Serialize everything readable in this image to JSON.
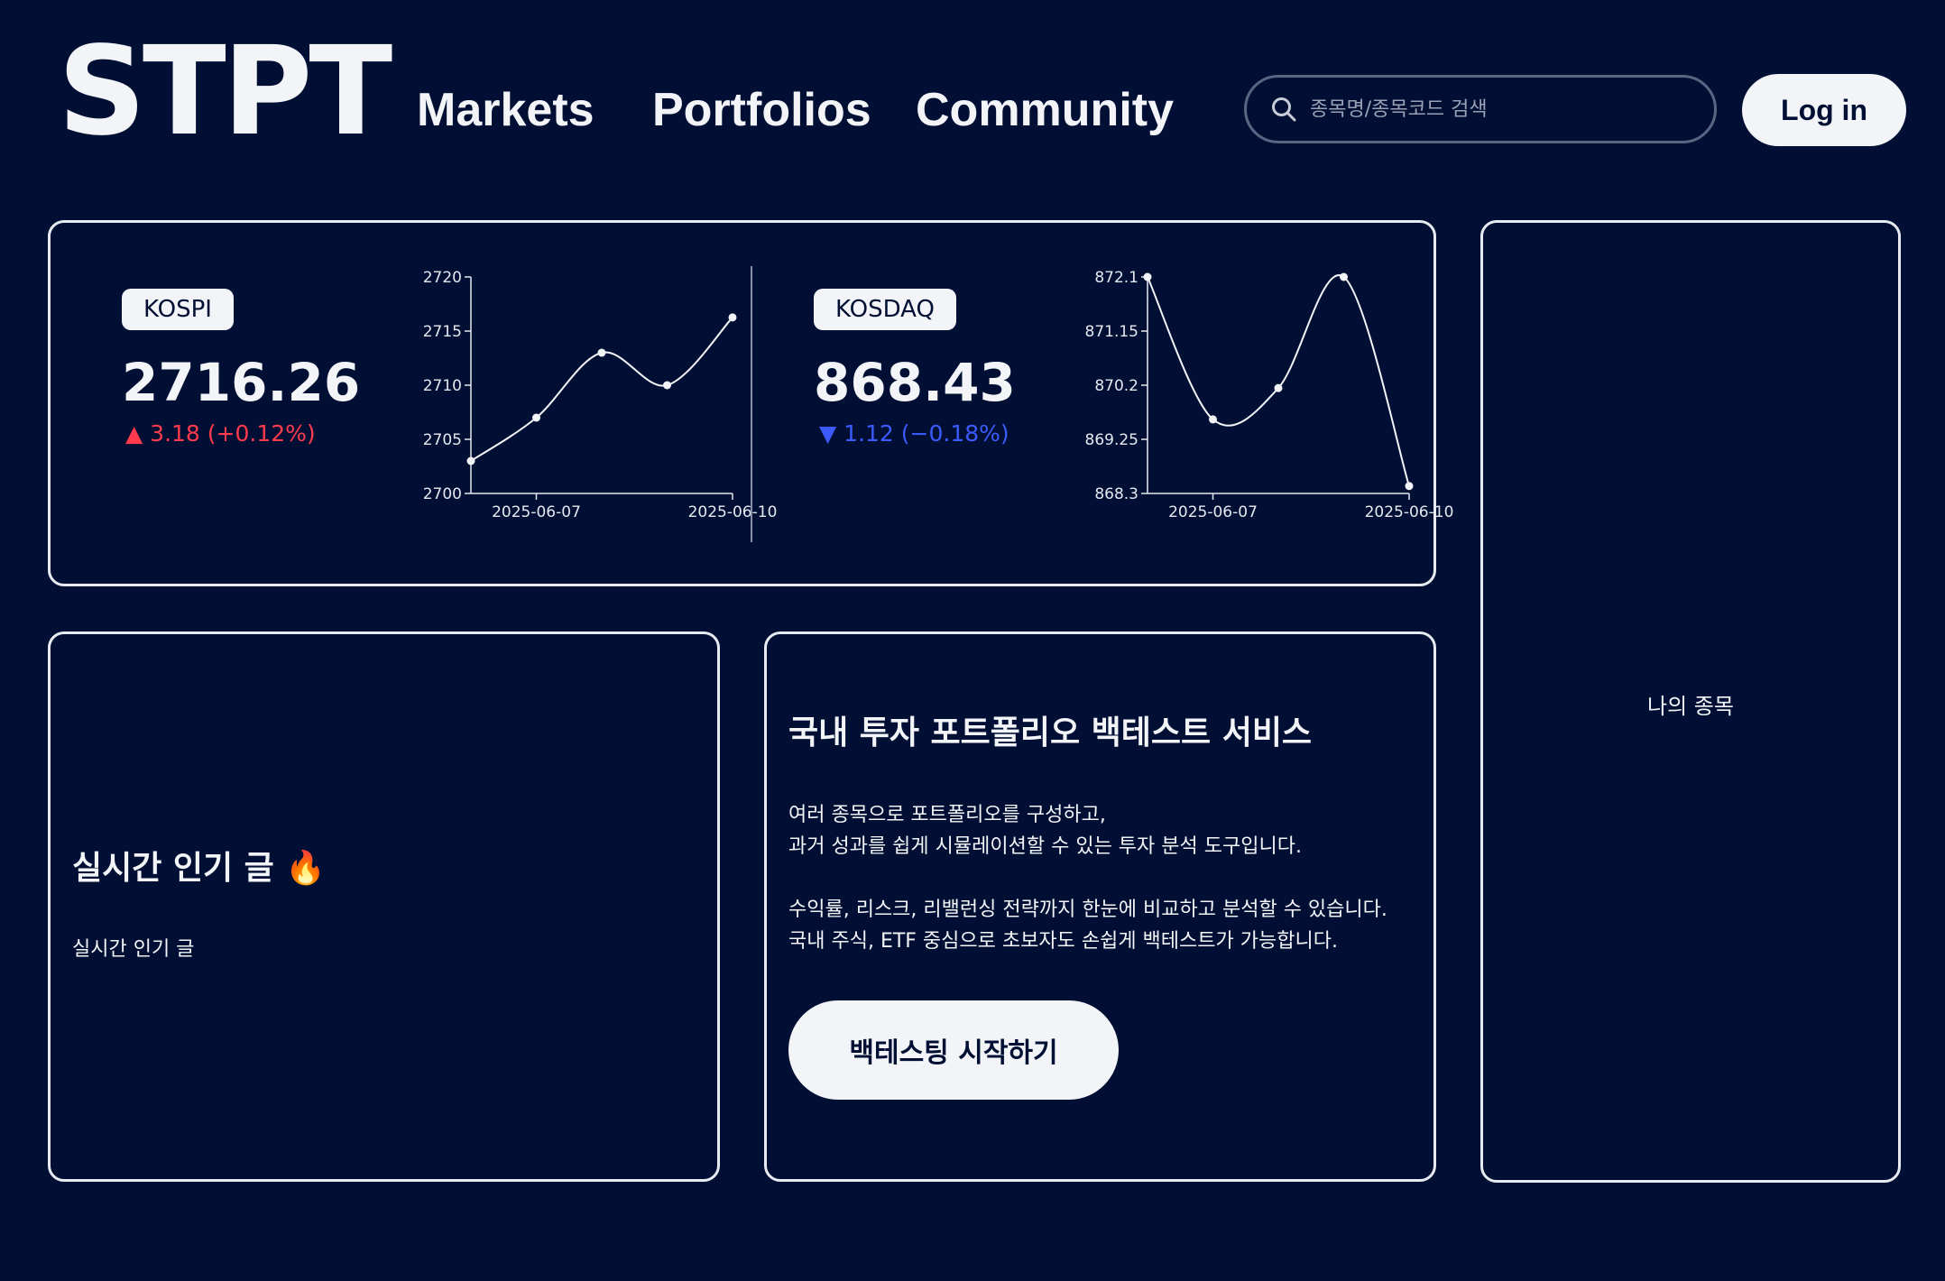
{
  "header": {
    "logo": "STPT",
    "nav": {
      "markets": "Markets",
      "portfolios": "Portfolios",
      "community": "Community"
    },
    "search": {
      "placeholder": "종목명/종목코드 검색",
      "icon": "search-icon"
    },
    "login_label": "Log in"
  },
  "indices": {
    "kospi": {
      "name": "KOSPI",
      "value": "2716.26",
      "change": "▲ 3.18 (+0.12%)",
      "direction": "up"
    },
    "kosdaq": {
      "name": "KOSDAQ",
      "value": "868.43",
      "change": "▼ 1.12 (−0.18%)",
      "direction": "down"
    }
  },
  "chart_data": [
    {
      "type": "line",
      "title": "",
      "xlabel": "",
      "ylabel": "",
      "x": [
        "2025-06-06",
        "2025-06-07",
        "2025-06-08",
        "2025-06-09",
        "2025-06-10"
      ],
      "series": [
        {
          "values": [
            2703,
            2707,
            2713,
            2710,
            2716.26
          ]
        }
      ],
      "ylim": [
        2700,
        2720
      ],
      "y_ticks": [
        "2700",
        "2705",
        "2710",
        "2715",
        "2720"
      ],
      "x_ticks": [
        "2025-06-07",
        "2025-06-10"
      ],
      "grid": false
    },
    {
      "type": "line",
      "title": "",
      "xlabel": "",
      "ylabel": "",
      "x": [
        "2025-06-06",
        "2025-06-07",
        "2025-06-08",
        "2025-06-09",
        "2025-06-10"
      ],
      "series": [
        {
          "values": [
            872.1,
            869.6,
            870.15,
            872.1,
            868.43
          ]
        }
      ],
      "ylim": [
        868.3,
        872.1
      ],
      "y_ticks": [
        "868.3",
        "869.25",
        "870.2",
        "871.15",
        "872.1"
      ],
      "x_ticks": [
        "2025-06-07",
        "2025-06-10"
      ],
      "grid": false
    }
  ],
  "popular": {
    "title": "실시간 인기 글 🔥",
    "body": "실시간 인기 글"
  },
  "backtest": {
    "title": "국내 투자 포트폴리오 백테스트 서비스",
    "paragraph1": "여러 종목으로 포트폴리오를 구성하고,\n과거 성과를 쉽게 시뮬레이션할 수 있는 투자 분석 도구입니다.",
    "paragraph2": "수익률, 리스크, 리밸런싱 전략까지 한눈에 비교하고 분석할 수 있습니다.\n국내 주식, ETF 중심으로 초보자도 손쉽게 백테스트가 가능합니다.",
    "cta_label": "백테스팅 시작하기"
  },
  "my_stocks": {
    "label": "나의 종목"
  },
  "colors": {
    "background": "#000f33",
    "up": "#ff3b4d",
    "down": "#3b5bff",
    "surface": "#f3f4f8"
  }
}
